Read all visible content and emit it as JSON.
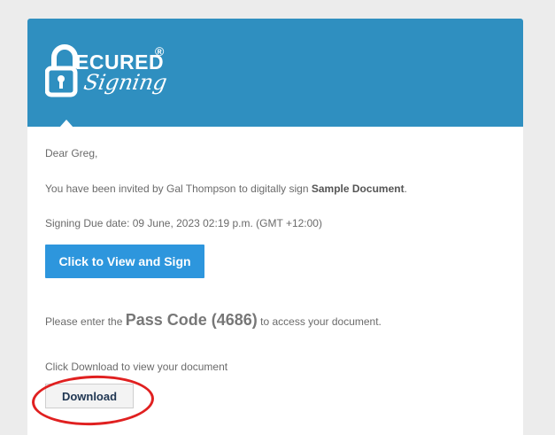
{
  "brand": {
    "logo_word": "ECURED",
    "logo_script": "Signing",
    "logo_reg": "®"
  },
  "email": {
    "greeting": "Dear Greg,",
    "invite_prefix": "You have been invited by Gal Thompson to digitally sign ",
    "document_name": "Sample Document",
    "invite_suffix": ".",
    "due_text": "Signing Due date: 09 June, 2023 02:19 p.m. (GMT +12:00)",
    "view_sign_label": "Click to View and Sign",
    "pass_prefix": "Please enter the ",
    "pass_code": "Pass Code (4686)",
    "pass_suffix": " to access your document.",
    "download_text": "Click Download to view your document",
    "download_label": "Download"
  },
  "colors": {
    "header": "#2f8fc0",
    "button": "#2d96dd",
    "annotation": "#e02020"
  }
}
